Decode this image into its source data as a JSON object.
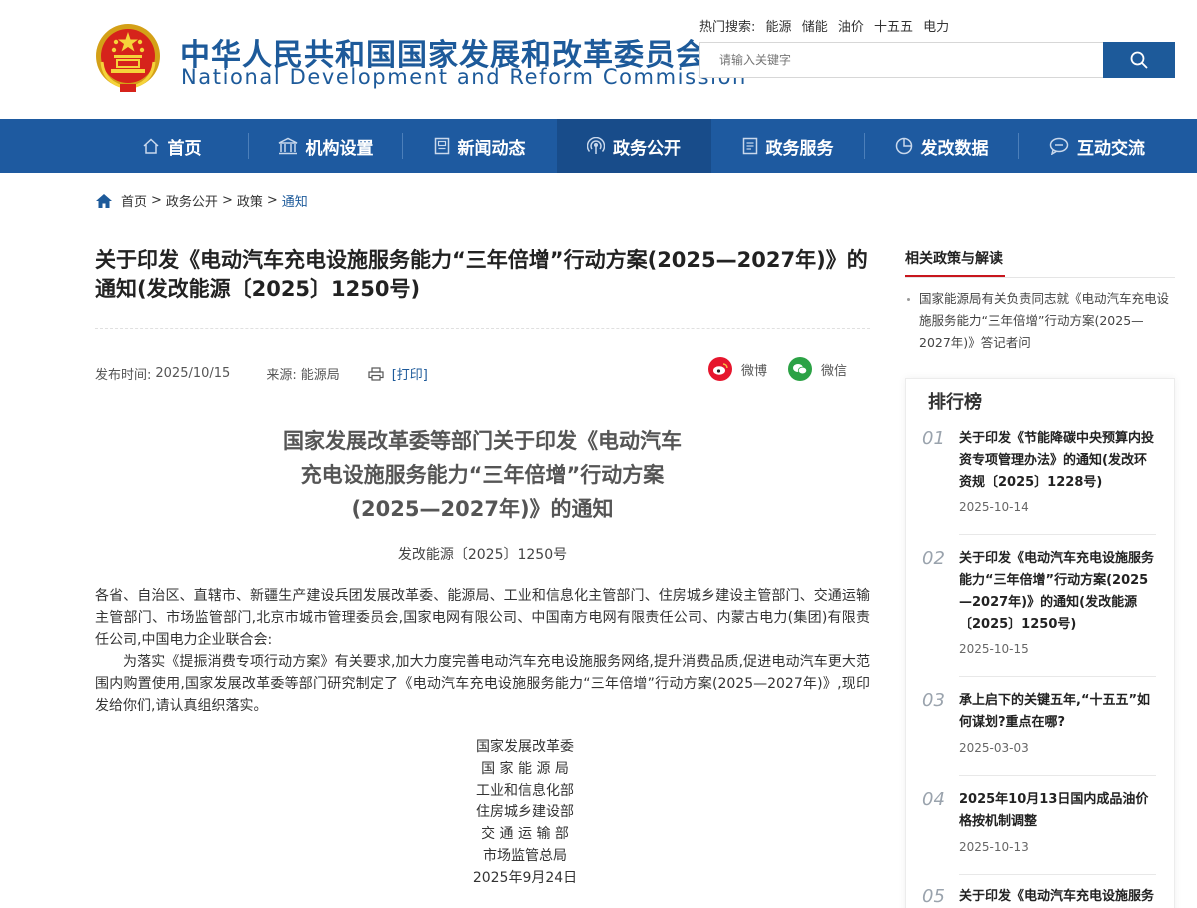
{
  "header": {
    "title_cn": "中华人民共和国国家发展和改革委员会",
    "title_en": "National Development and Reform Commission",
    "hot_label": "热门搜索:",
    "hot_words": [
      "能源",
      "储能",
      "油价",
      "十五五",
      "电力"
    ],
    "search_placeholder": "请输入关键字",
    "accent_color": "#1d5a9a"
  },
  "nav": {
    "items": [
      {
        "label": "首页",
        "icon": "home-icon"
      },
      {
        "label": "机构设置",
        "icon": "building-icon"
      },
      {
        "label": "新闻动态",
        "icon": "news-icon"
      },
      {
        "label": "政务公开",
        "icon": "broadcast-icon",
        "active": true
      },
      {
        "label": "政务服务",
        "icon": "document-icon"
      },
      {
        "label": "发改数据",
        "icon": "pie-chart-icon"
      },
      {
        "label": "互动交流",
        "icon": "chat-icon"
      }
    ]
  },
  "breadcrumb": {
    "items": [
      "首页",
      "政务公开",
      "政策"
    ],
    "current": "通知",
    "separator": ">"
  },
  "article": {
    "title": "关于印发《电动汽车充电设施服务能力“三年倍增”行动方案(2025—2027年)》的通知(发改能源〔2025〕1250号)",
    "publish_label": "发布时间:",
    "publish_date": "2025/10/15",
    "source_label": "来源:",
    "source": "能源局",
    "print_label": "[打印]",
    "share_weibo": "微博",
    "share_wechat": "微信",
    "doc_title_lines": [
      "国家发展改革委等部门关于印发《电动汽车",
      "充电设施服务能力“三年倍增”行动方案",
      "(2025—2027年)》的通知"
    ],
    "doc_number": "发改能源〔2025〕1250号",
    "addressees": "各省、自治区、直辖市、新疆生产建设兵团发展改革委、能源局、工业和信息化主管部门、住房城乡建设主管部门、交通运输主管部门、市场监管部门,北京市城市管理委员会,国家电网有限公司、中国南方电网有限责任公司、内蒙古电力(集团)有限责任公司,中国电力企业联合会:",
    "paragraph": "为落实《提振消费专项行动方案》有关要求,加大力度完善电动汽车充电设施服务网络,提升消费品质,促进电动汽车更大范围内购置使用,国家发展改革委等部门研究制定了《电动汽车充电设施服务能力“三年倍增”行动方案(2025—2027年)》,现印发给你们,请认真组织落实。",
    "signers": [
      "国家发展改革委",
      "国 家 能 源 局",
      "工业和信息化部",
      "住房城乡建设部",
      "交 通 运 输 部",
      "市场监管总局",
      "2025年9月24日"
    ]
  },
  "sidebar": {
    "related_heading": "相关政策与解读",
    "related_items": [
      "国家能源局有关负责同志就《电动汽车充电设施服务能力“三年倍增”行动方案(2025—2027年)》答记者问"
    ],
    "ranking_heading": "排行榜",
    "ranking": [
      {
        "num": "01",
        "title": "关于印发《节能降碳中央预算内投资专项管理办法》的通知(发改环资规〔2025〕1228号)",
        "date": "2025-10-14"
      },
      {
        "num": "02",
        "title": "关于印发《电动汽车充电设施服务能力“三年倍增”行动方案(2025—2027年)》的通知(发改能源〔2025〕1250号)",
        "date": "2025-10-15"
      },
      {
        "num": "03",
        "title": "承上启下的关键五年,“十五五”如何谋划?重点在哪?",
        "date": "2025-03-03"
      },
      {
        "num": "04",
        "title": "2025年10月13日国内成品油价格按机制调整",
        "date": "2025-10-13"
      },
      {
        "num": "05",
        "title": "关于印发《电动汽车充电设施服务",
        "date": ""
      }
    ]
  }
}
